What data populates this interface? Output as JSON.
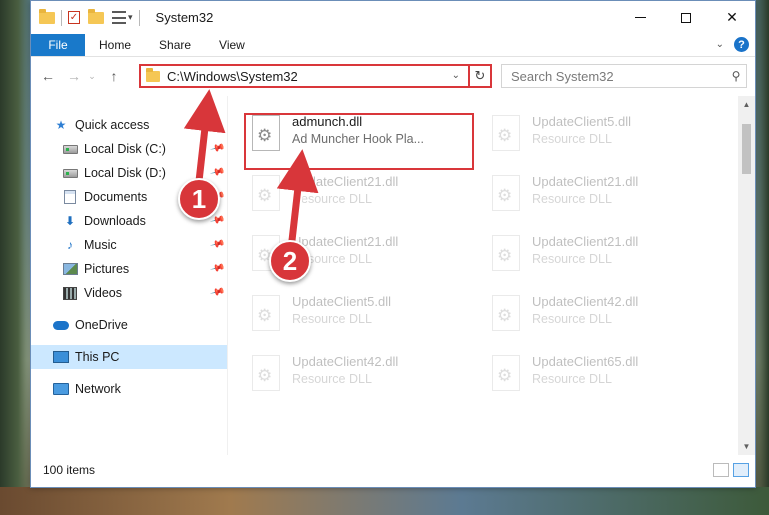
{
  "window": {
    "title": "System32"
  },
  "ribbon": {
    "tabs": [
      "File",
      "Home",
      "Share",
      "View"
    ]
  },
  "address": {
    "path": "C:\\Windows\\System32",
    "search_placeholder": "Search System32"
  },
  "sidebar": {
    "items": [
      {
        "label": "Quick access",
        "icon": "star-icon",
        "level": 1,
        "pinned": false
      },
      {
        "label": "Local Disk (C:)",
        "icon": "disk-icon",
        "level": 2,
        "pinned": true
      },
      {
        "label": "Local Disk (D:)",
        "icon": "disk-icon",
        "level": 2,
        "pinned": true
      },
      {
        "label": "Documents",
        "icon": "documents-icon",
        "level": 2,
        "pinned": true
      },
      {
        "label": "Downloads",
        "icon": "downloads-icon",
        "level": 2,
        "pinned": true
      },
      {
        "label": "Music",
        "icon": "music-icon",
        "level": 2,
        "pinned": true
      },
      {
        "label": "Pictures",
        "icon": "pictures-icon",
        "level": 2,
        "pinned": true
      },
      {
        "label": "Videos",
        "icon": "videos-icon",
        "level": 2,
        "pinned": true
      },
      {
        "label": "OneDrive",
        "icon": "onedrive-icon",
        "level": 1,
        "pinned": false
      },
      {
        "label": "This PC",
        "icon": "this-pc-icon",
        "level": 1,
        "pinned": false,
        "selected": true
      },
      {
        "label": "Network",
        "icon": "network-icon",
        "level": 1,
        "pinned": false
      }
    ]
  },
  "files": [
    {
      "name": "admunch.dll",
      "desc": "Ad Muncher Hook Pla...",
      "faded": false
    },
    {
      "name": "UpdateClient5.dll",
      "desc": "Resource DLL",
      "faded": true
    },
    {
      "name": "UpdateClient21.dll",
      "desc": "Resource DLL",
      "faded": true
    },
    {
      "name": "UpdateClient21.dll",
      "desc": "Resource DLL",
      "faded": true
    },
    {
      "name": "UpdateClient21.dll",
      "desc": "Resource DLL",
      "faded": true
    },
    {
      "name": "UpdateClient21.dll",
      "desc": "Resource DLL",
      "faded": true
    },
    {
      "name": "UpdateClient5.dll",
      "desc": "Resource DLL",
      "faded": true
    },
    {
      "name": "UpdateClient42.dll",
      "desc": "Resource DLL",
      "faded": true
    },
    {
      "name": "UpdateClient42.dll",
      "desc": "Resource DLL",
      "faded": true
    },
    {
      "name": "UpdateClient65.dll",
      "desc": "Resource DLL",
      "faded": true
    }
  ],
  "status": {
    "item_count": "100 items"
  },
  "annotations": {
    "step1": "1",
    "step2": "2",
    "highlight_color": "#d9363a"
  }
}
